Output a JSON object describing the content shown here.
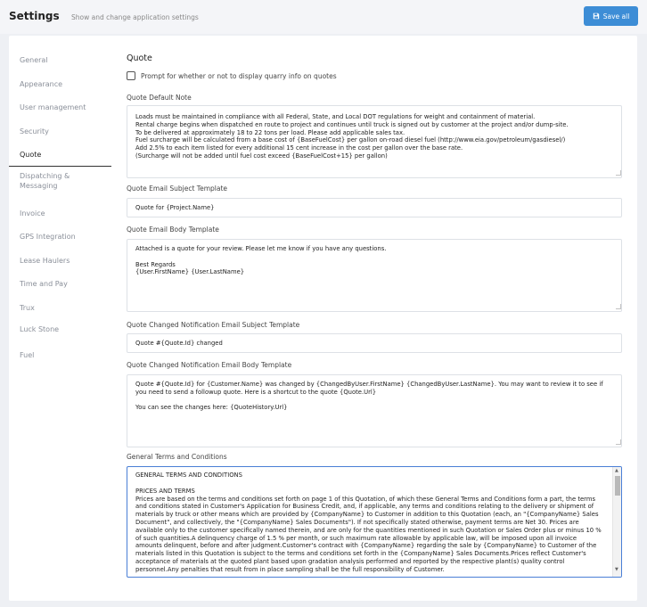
{
  "header": {
    "title": "Settings",
    "subtitle": "Show and change application settings",
    "save_label": "Save all"
  },
  "sidebar": {
    "items": [
      {
        "label": "General"
      },
      {
        "label": "Appearance"
      },
      {
        "label": "User management"
      },
      {
        "label": "Security"
      },
      {
        "label": "Quote",
        "active": true
      },
      {
        "label": "Dispatching & Messaging"
      },
      {
        "label": "Invoice"
      },
      {
        "label": "GPS Integration"
      },
      {
        "label": "Lease Haulers"
      },
      {
        "label": "Time and Pay"
      },
      {
        "label": "Trux"
      },
      {
        "label": "Luck Stone"
      },
      {
        "label": "Fuel"
      }
    ]
  },
  "quote": {
    "section_title": "Quote",
    "prompt_checkbox_label": "Prompt for whether or not to display quarry info on quotes",
    "default_note_label": "Quote Default Note",
    "default_note_value": "Loads must be maintained in compliance with all Federal, State, and Local DOT regulations for weight and containment of material.\nRental charge begins when dispatched en route to project and continues until truck is signed out by customer at the project and/or dump-site.\nTo be delivered at approximately 18 to 22 tons per load. Please add applicable sales tax.\nFuel surcharge will be calculated from a base cost of {BaseFuelCost} per gallon on-road diesel fuel (http://www.eia.gov/petroleum/gasdiesel/)\nAdd 2.5% to each item listed for every additional 15 cent increase in the cost per gallon over the base rate.\n(Surcharge will not be added until fuel cost exceed {BaseFuelCost+15} per gallon)",
    "email_subject_label": "Quote Email Subject Template",
    "email_subject_value": "Quote for {Project.Name}",
    "email_body_label": "Quote Email Body Template",
    "email_body_value": "Attached is a quote for your review. Please let me know if you have any questions.\n\nBest Regards\n{User.FirstName} {User.LastName}",
    "changed_subject_label": "Quote Changed Notification Email Subject Template",
    "changed_subject_value": "Quote #{Quote.Id} changed",
    "changed_body_label": "Quote Changed Notification Email Body Template",
    "changed_body_value": "Quote #{Quote.Id} for {Customer.Name} was changed by {ChangedByUser.FirstName} {ChangedByUser.LastName}. You may want to review it to see if you need to send a followup quote. Here is a shortcut to the quote {Quote.Url}\n\nYou can see the changes here: {QuoteHistory.Url}",
    "terms_label": "General Terms and Conditions",
    "terms_heading": "GENERAL TERMS AND CONDITIONS",
    "terms_subheading": "PRICES AND TERMS",
    "terms_body": "Prices are based on the terms and conditions set forth on page 1 of this Quotation, of which these General Terms and Conditions form a part, the terms and conditions stated in Customer's Application for Business Credit, and, if applicable, any terms and conditions relating to the delivery or shipment of materials by truck or other means which are provided by {CompanyName} to Customer in addition to this Quotation (each, an \"{CompanyName} Sales Document\", and collectively, the \"{CompanyName} Sales Documents\"). If not specifically stated otherwise, payment terms are Net 30. Prices are available only to the customer specifically named therein, and are only for the quantities mentioned in such Quotation or Sales Order plus or minus 10 % of such quantities.A delinquency charge of 1.5 % per month, or such maximum rate allowable by applicable law, will be imposed upon all invoice amounts delinquent, before and after judgment.Customer's contract with {CompanyName} regarding the sale by {CompanyName} to Customer of the materials listed in this Quotation is subject to the terms and conditions set forth in the {CompanyName} Sales Documents.Prices reflect Customer's acceptance of materials at the quoted plant based upon gradation analysis performed and reported by the respective plant(s) quality control personnel.Any penalties that result from in place sampling shall be the full responsibility of Customer."
  },
  "colors": {
    "accent": "#3d8dd6",
    "background": "#eef0f4",
    "card": "#ffffff"
  },
  "icons": {
    "save": "floppy-disk-icon"
  }
}
